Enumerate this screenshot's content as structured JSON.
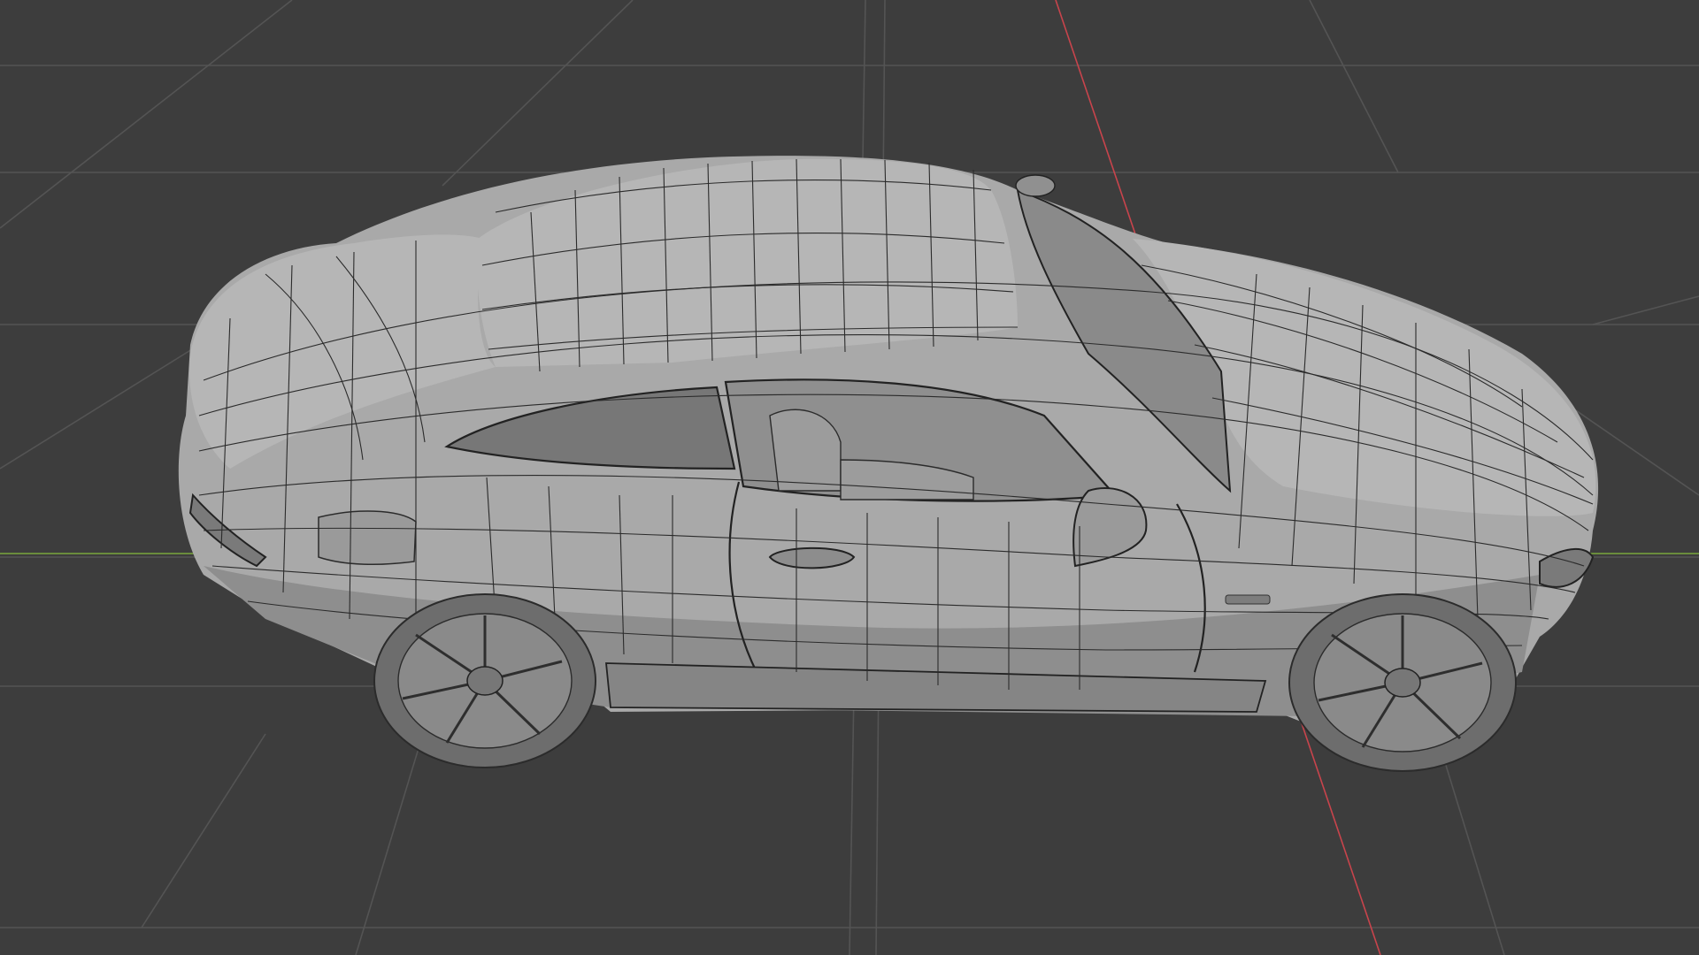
{
  "viewport": {
    "name": "3D Viewport",
    "shading": "wireframe",
    "background_color": "#3d3d3d",
    "grid_color": "#545454",
    "x_axis_color": "#c8444c",
    "y_axis_color": "#7aa83c",
    "object": "car-coupe-mesh"
  }
}
